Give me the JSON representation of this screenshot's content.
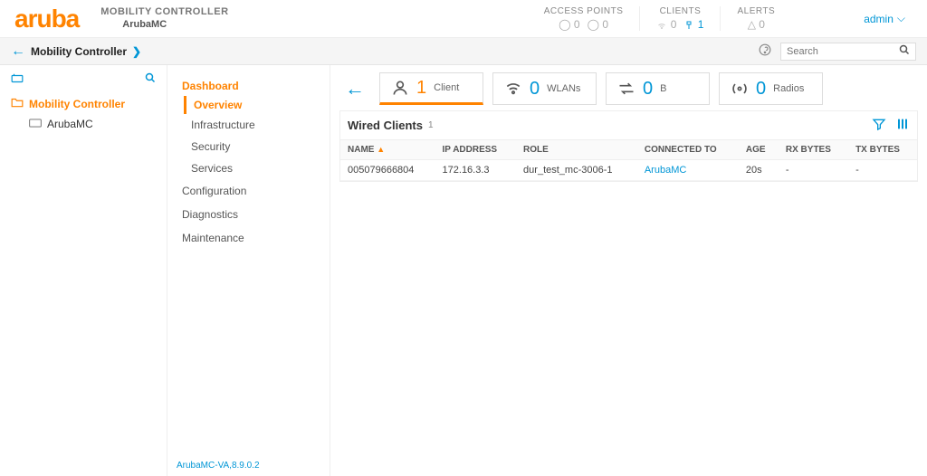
{
  "brand": "aruba",
  "header": {
    "title_line1": "MOBILITY CONTROLLER",
    "title_line2": "ArubaMC",
    "status": {
      "access_points": {
        "label": "ACCESS POINTS",
        "a": "0",
        "b": "0"
      },
      "clients": {
        "label": "CLIENTS",
        "a": "0",
        "b": "1",
        "b_highlight": true
      },
      "alerts": {
        "label": "ALERTS",
        "a": "0"
      }
    },
    "user": "admin"
  },
  "crumb": {
    "title": "Mobility Controller"
  },
  "search": {
    "placeholder": "Search"
  },
  "tree": {
    "root": "Mobility Controller",
    "child": "ArubaMC"
  },
  "nav": {
    "dashboard": "Dashboard",
    "overview": "Overview",
    "infrastructure": "Infrastructure",
    "security": "Security",
    "services": "Services",
    "configuration": "Configuration",
    "diagnostics": "Diagnostics",
    "maintenance": "Maintenance",
    "version": "ArubaMC-VA,8.9.0.2"
  },
  "stats": {
    "client": {
      "num": "1",
      "label": "Client"
    },
    "wlans": {
      "num": "0",
      "label": "WLANs"
    },
    "b": {
      "num": "0",
      "label": "B"
    },
    "radios": {
      "num": "0",
      "label": "Radios"
    }
  },
  "panel": {
    "title": "Wired Clients",
    "count": "1",
    "columns": {
      "name": "NAME",
      "ip": "IP ADDRESS",
      "role": "ROLE",
      "connected": "CONNECTED TO",
      "age": "AGE",
      "rx": "RX BYTES",
      "tx": "TX BYTES"
    },
    "rows": [
      {
        "name": "005079666804",
        "ip": "172.16.3.3",
        "role": "dur_test_mc-3006-1",
        "connected": "ArubaMC",
        "age": "20s",
        "rx": "-",
        "tx": "-"
      }
    ]
  }
}
